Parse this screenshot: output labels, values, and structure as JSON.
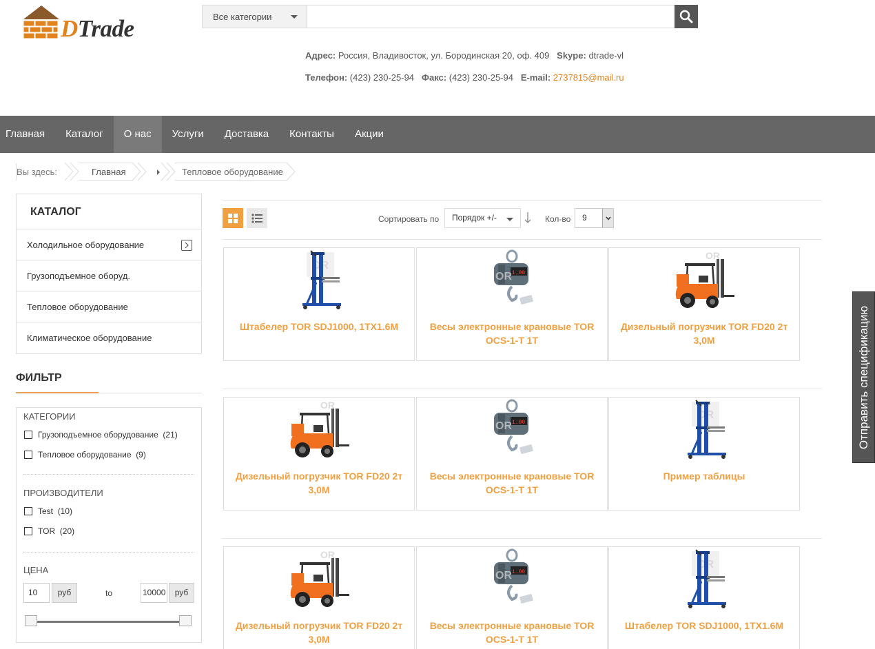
{
  "logo": {
    "text_d": "D",
    "text_rest": "Trade"
  },
  "search": {
    "category": "Все категории",
    "placeholder": ""
  },
  "contacts": {
    "address_label": "Адрес:",
    "address": "Россия, Владивосток, ул. Бородинская 20, оф. 409",
    "skype_label": "Skype:",
    "skype": "dtrade-vl",
    "phone_label": "Телефон:",
    "phone": "(423) 230-25-94",
    "fax_label": "Факс:",
    "fax": "(423) 230-25-94",
    "email_label": "E-mail:",
    "email": "2737815@mail.ru"
  },
  "nav": [
    "Главная",
    "Каталог",
    "О нас",
    "Услуги",
    "Доставка",
    "Контакты",
    "Акции"
  ],
  "nav_active": "О нас",
  "breadcrumb": {
    "here": "Вы здесь:",
    "home": "Главная",
    "current": "Тепловое оборудование"
  },
  "catalog": {
    "title": "КАТАЛОГ",
    "items": [
      "Холодильное оборудование",
      "Грузоподъемное оборуд.",
      "Тепловое оборудование",
      "Климатическое оборудование"
    ]
  },
  "filter": {
    "title": "ФИЛЬТР",
    "categories_title": "КАТЕГОРИИ",
    "categories": [
      {
        "label": "Грузоподъемное оборудование",
        "count": "(21)"
      },
      {
        "label": "Тепловое оборудование",
        "count": "(9)"
      }
    ],
    "makers_title": "ПРОИЗВОДИТЕЛИ",
    "makers": [
      {
        "label": "Test",
        "count": "(10)"
      },
      {
        "label": "TOR",
        "count": "(20)"
      }
    ],
    "price_title": "ЦЕНА",
    "price_from": "10",
    "price_to": "10000",
    "currency": "руб",
    "to_label": "to",
    "slider_min": 0,
    "slider_max": 1
  },
  "toolbar": {
    "sort_label": "Сортировать по",
    "sort_value": "Порядок +/-",
    "qty_label": "Кол-во",
    "qty_value": "9"
  },
  "products": [
    {
      "title": "Штабелер TOR SDJ1000, 1TX1.6M",
      "image": "stacker"
    },
    {
      "title": "Весы электронные крановые TOR OCS-1-T 1T",
      "image": "scale"
    },
    {
      "title": "Дизельный погрузчик TOR FD20 2т 3,0M",
      "image": "forklift"
    },
    {
      "title": "Дизельный погрузчик TOR FD20 2т 3,0M",
      "image": "forklift"
    },
    {
      "title": "Весы электронные крановые TOR OCS-1-T 1T",
      "image": "scale"
    },
    {
      "title": "Пример таблицы",
      "image": "stacker"
    },
    {
      "title": "Дизельный погрузчик TOR FD20 2т 3,0M",
      "image": "forklift"
    },
    {
      "title": "Весы электронные крановые TOR OCS-1-T 1T",
      "image": "scale"
    },
    {
      "title": "Штабелер TOR SDJ1000, 1TX1.6M",
      "image": "stacker"
    }
  ],
  "spec_tab": "Отправить спецификацию",
  "colors": {
    "accent": "#f0a040",
    "nav": "#666666",
    "nav_active": "#7a7a7a"
  }
}
